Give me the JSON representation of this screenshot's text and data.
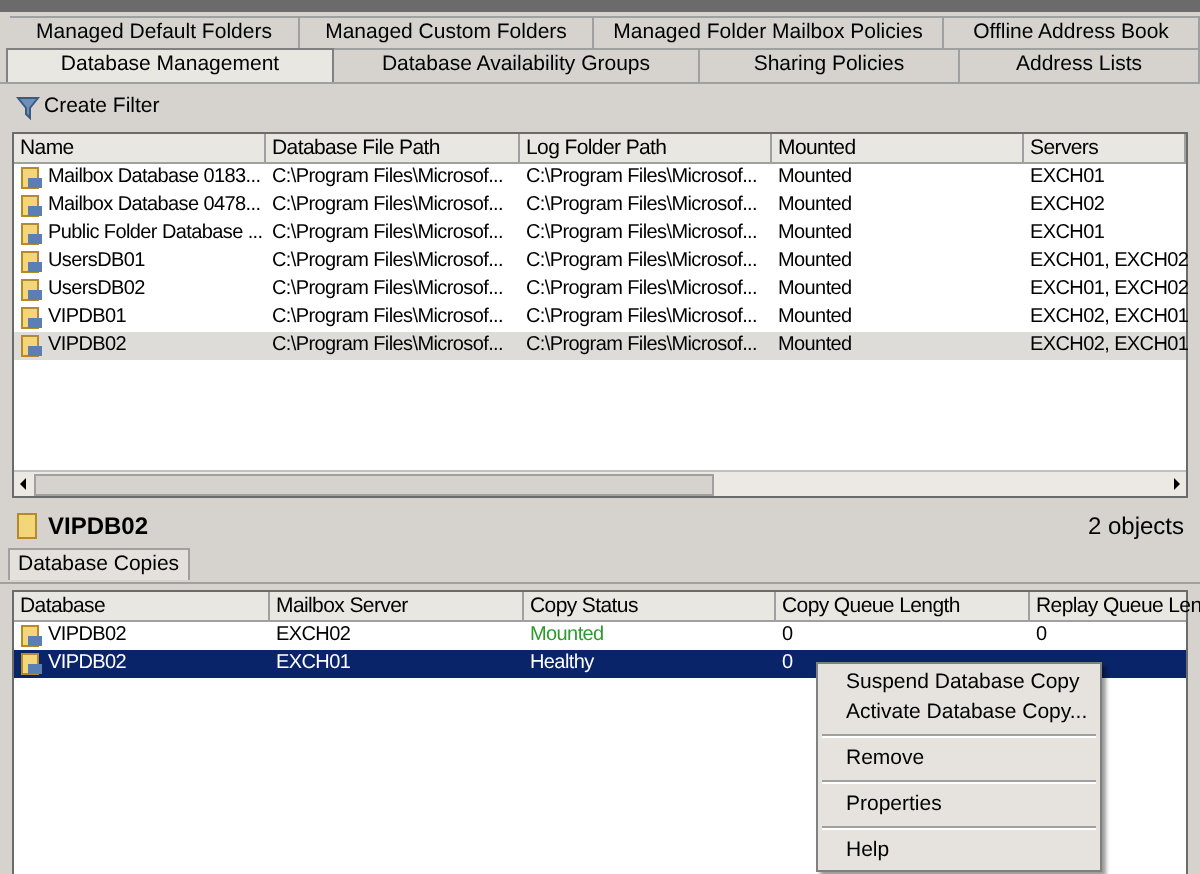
{
  "tabs_row_1": [
    {
      "label": "Managed Default Folders",
      "selected": false
    },
    {
      "label": "Managed Custom Folders",
      "selected": false
    },
    {
      "label": "Managed Folder Mailbox Policies",
      "selected": false
    },
    {
      "label": "Offline Address Book",
      "selected": false
    }
  ],
  "tabs_row_2": [
    {
      "label": "Database Management",
      "selected": true
    },
    {
      "label": "Database Availability Groups",
      "selected": false
    },
    {
      "label": "Sharing Policies",
      "selected": false
    },
    {
      "label": "Address Lists",
      "selected": false
    }
  ],
  "toolbar": {
    "create_filter": "Create Filter"
  },
  "databases": {
    "columns": [
      "Name",
      "Database File Path",
      "Log Folder Path",
      "Mounted",
      "Servers"
    ],
    "rows": [
      {
        "cells": [
          "Mailbox Database 0183...",
          "C:\\Program Files\\Microsof...",
          "C:\\Program Files\\Microsof...",
          "Mounted",
          "EXCH01"
        ],
        "selected": false
      },
      {
        "cells": [
          "Mailbox Database 0478...",
          "C:\\Program Files\\Microsof...",
          "C:\\Program Files\\Microsof...",
          "Mounted",
          "EXCH02"
        ],
        "selected": false
      },
      {
        "cells": [
          "Public Folder Database ...",
          "C:\\Program Files\\Microsof...",
          "C:\\Program Files\\Microsof...",
          "Mounted",
          "EXCH01"
        ],
        "selected": false
      },
      {
        "cells": [
          "UsersDB01",
          "C:\\Program Files\\Microsof...",
          "C:\\Program Files\\Microsof...",
          "Mounted",
          "EXCH01, EXCH02"
        ],
        "selected": false
      },
      {
        "cells": [
          "UsersDB02",
          "C:\\Program Files\\Microsof...",
          "C:\\Program Files\\Microsof...",
          "Mounted",
          "EXCH01, EXCH02"
        ],
        "selected": false
      },
      {
        "cells": [
          "VIPDB01",
          "C:\\Program Files\\Microsof...",
          "C:\\Program Files\\Microsof...",
          "Mounted",
          "EXCH02, EXCH01"
        ],
        "selected": false
      },
      {
        "cells": [
          "VIPDB02",
          "C:\\Program Files\\Microsof...",
          "C:\\Program Files\\Microsof...",
          "Mounted",
          "EXCH02, EXCH01"
        ],
        "selected": true
      }
    ]
  },
  "detail": {
    "title": "VIPDB02",
    "count": "2 objects",
    "tab": "Database Copies"
  },
  "copies": {
    "columns": [
      "Database",
      "Mailbox Server",
      "Copy Status",
      "Copy Queue Length",
      "Replay Queue Len"
    ],
    "rows": [
      {
        "cells": [
          "VIPDB02",
          "EXCH02",
          "Mounted",
          "0",
          "0"
        ],
        "selected": false,
        "color": "#2e9a2e"
      },
      {
        "cells": [
          "VIPDB02",
          "EXCH01",
          "Healthy",
          "0"
        ],
        "selected": true
      }
    ]
  },
  "context_menu": [
    [
      "Suspend Database Copy",
      "Activate Database Copy..."
    ],
    [
      "Remove"
    ],
    [
      "Properties"
    ],
    [
      "Help"
    ]
  ]
}
